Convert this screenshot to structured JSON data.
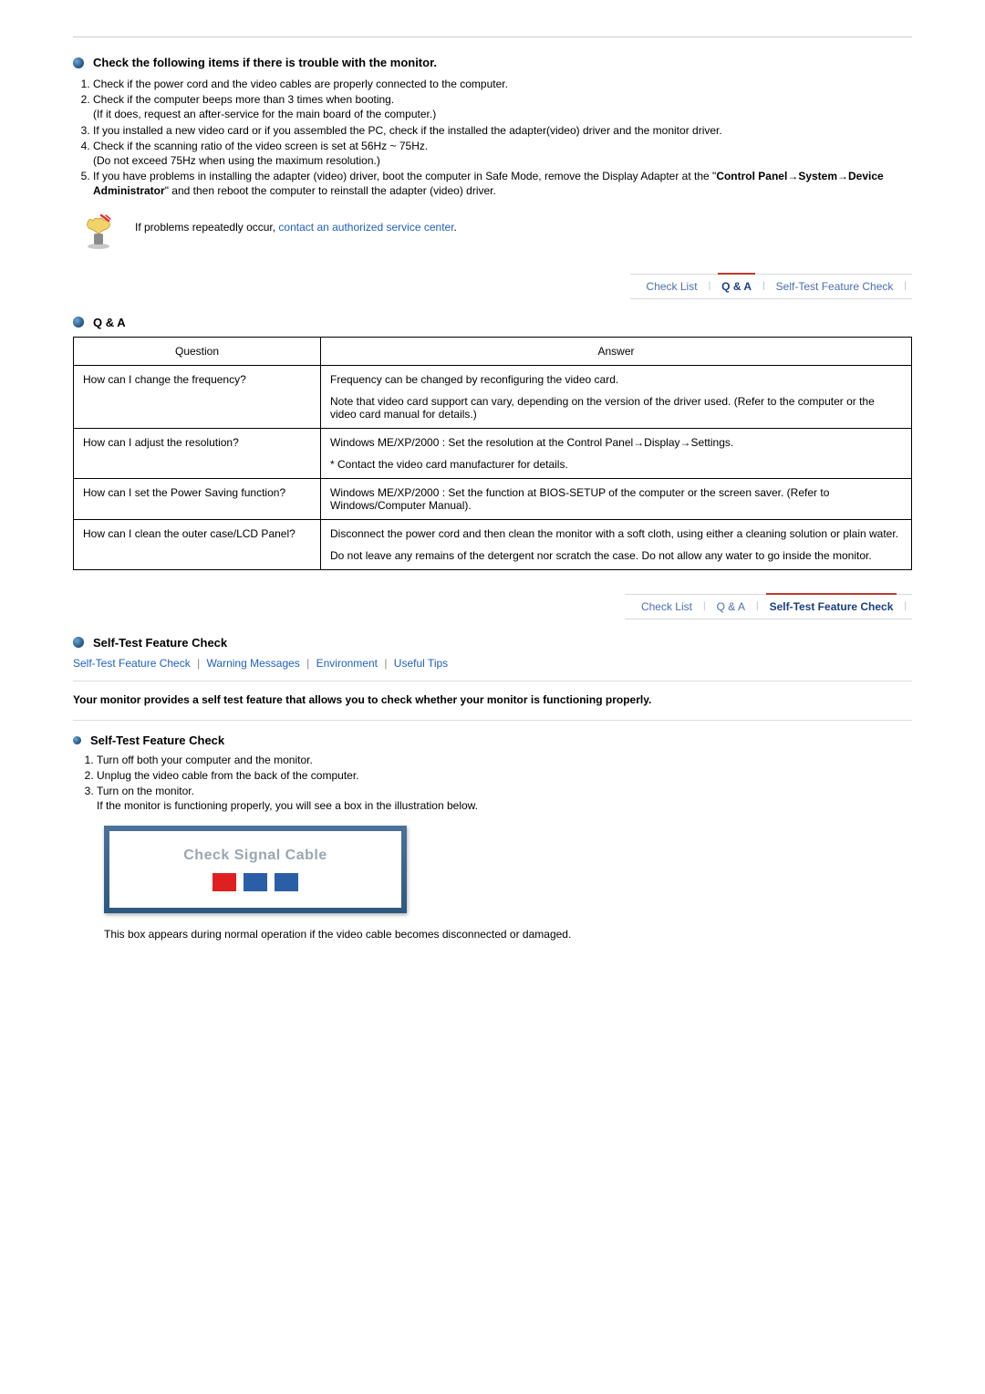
{
  "check": {
    "title": "Check the following items if there is trouble with the monitor.",
    "items": [
      "Check if the power cord and the video cables are properly connected to the computer.",
      "Check if the computer beeps more than 3 times when booting.",
      "If you installed a new video card or if you assembled the PC, check if the installed the adapter(video) driver and the monitor driver.",
      "Check if the scanning ratio of the video screen is set at 56Hz ~ 75Hz.",
      "If you have problems in installing the adapter (video) driver, boot the computer in Safe Mode, remove the Display Adapter at the \""
    ],
    "sub2": "(If it does, request an after-service for the main board of the computer.)",
    "sub4": "(Do not exceed 75Hz when using the maximum resolution.)",
    "item5_bold": "Control Panel→System→Device Administrator",
    "item5_tail": "\" and then reboot the computer to reinstall the adapter (video) driver.",
    "note_prefix": "If problems repeatedly occur, ",
    "note_link": "contact an authorized service center",
    "note_suffix": "."
  },
  "tabs": {
    "check": "Check List",
    "qa": "Q & A",
    "self": "Self-Test Feature Check"
  },
  "qa": {
    "title": "Q & A",
    "col_q": "Question",
    "col_a": "Answer",
    "rows": [
      {
        "q": "How can I change the frequency?",
        "a1": "Frequency can be changed by reconfiguring the video card.",
        "a2": "Note that video card support can vary, depending on the version of the driver used. (Refer to the computer or the video card manual for details.)"
      },
      {
        "q": "How can I adjust the resolution?",
        "a1": "Windows ME/XP/2000 : Set the resolution at the Control Panel→Display→Settings.",
        "a2": "* Contact the video card manufacturer for details."
      },
      {
        "q": "How can I set the Power Saving function?",
        "a1": "Windows ME/XP/2000 : Set the function at BIOS-SETUP of the computer or the screen saver. (Refer to Windows/Computer Manual)."
      },
      {
        "q": "How can I clean the outer case/LCD Panel?",
        "a1": "Disconnect the power cord and then clean the monitor with a soft cloth, using either a cleaning solution or plain water.",
        "a2": "Do not leave any remains of the detergent nor scratch the case. Do not allow any water to go inside the monitor."
      }
    ]
  },
  "selftest": {
    "title": "Self-Test Feature Check",
    "links": {
      "a": "Self-Test Feature Check",
      "b": "Warning Messages",
      "c": "Environment",
      "d": "Useful Tips"
    },
    "intro": "Your monitor provides a self test feature that allows you to check whether your monitor is functioning properly.",
    "sub_title": "Self-Test Feature Check",
    "steps": {
      "s1": "Turn off both your computer and the monitor.",
      "s2": "Unplug the video cable from the back of the computer.",
      "s3": "Turn on the monitor.",
      "s3b": "If the monitor is functioning properly, you will see a box in the illustration below."
    },
    "signal": "Check Signal Cable",
    "note": "This box appears during normal operation if the video cable becomes disconnected or damaged."
  }
}
